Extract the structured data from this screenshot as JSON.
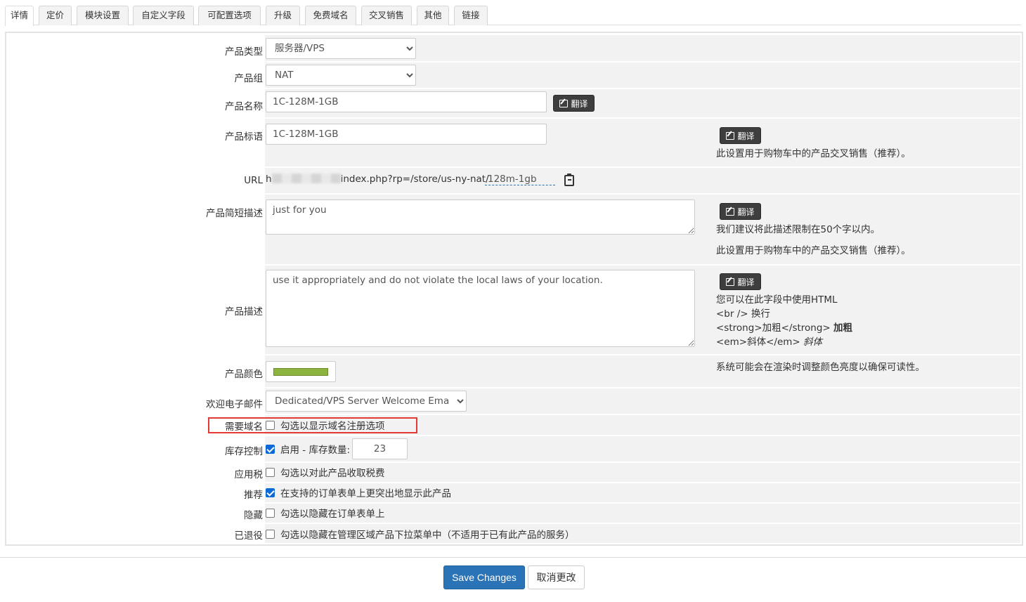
{
  "tabs": [
    "详情",
    "定价",
    "模块设置",
    "自定义字段",
    "可配置选项",
    "升级",
    "免费域名",
    "交叉销售",
    "其他",
    "链接"
  ],
  "active_tab": "详情",
  "fields": {
    "product_type": {
      "label": "产品类型",
      "value": "服务器/VPS"
    },
    "product_group": {
      "label": "产品组",
      "value": "NAT"
    },
    "product_name": {
      "label": "产品名称",
      "value": "1C-128M-1GB",
      "translate": "翻译"
    },
    "product_tagline": {
      "label": "产品标语",
      "value": "1C-128M-1GB",
      "translate": "翻译",
      "help": "此设置用于购物车中的产品交叉销售（推荐）。"
    },
    "url": {
      "label": "URL",
      "prefix_start": "h",
      "prefix_end": "index.php?rp=/store/us-ny-nat/",
      "slug": "128m-1gb"
    },
    "short_desc": {
      "label": "产品简短描述",
      "value": "just for you",
      "translate": "翻译",
      "help1": "我们建议将此描述限制在50个字以内。",
      "help2": "此设置用于购物车中的产品交叉销售（推荐）。"
    },
    "description": {
      "label": "产品描述",
      "value": "use it appropriately and do not violate the local laws of your location.",
      "translate": "翻译",
      "help_title": "您可以在此字段中使用HTML",
      "help_br": "<br /> 换行",
      "help_strong_code": "<strong>加粗</strong> ",
      "help_strong_demo": "加粗",
      "help_em_code": "<em>斜体</em> ",
      "help_em_demo": "斜体"
    },
    "color": {
      "label": "产品颜色",
      "value": "#8db43e",
      "help": "系统可能会在渲染时调整颜色亮度以确保可读性。"
    },
    "welcome_email": {
      "label": "欢迎电子邮件",
      "value": "Dedicated/VPS Server Welcome Email"
    },
    "require_domain": {
      "label": "需要域名",
      "checked": false,
      "text": "勾选以显示域名注册选项"
    },
    "stock_control": {
      "label": "库存控制",
      "checked": true,
      "text": "启用 - 库存数量:",
      "quantity": "23"
    },
    "tax": {
      "label": "应用税",
      "checked": false,
      "text": "勾选以对此产品收取税费"
    },
    "featured": {
      "label": "推荐",
      "checked": true,
      "text": "在支持的订单表单上更突出地显示此产品"
    },
    "hidden": {
      "label": "隐藏",
      "checked": false,
      "text": "勾选以隐藏在订单表单上"
    },
    "retired": {
      "label": "已退役",
      "checked": false,
      "text": "勾选以隐藏在管理区域产品下拉菜单中（不适用于已有此产品的服务）"
    }
  },
  "buttons": {
    "save": "Save Changes",
    "cancel": "取消更改"
  },
  "colors": {
    "primary": "#2a73b7",
    "highlight": "#e53935",
    "checkbox": "#0b6ad8"
  }
}
